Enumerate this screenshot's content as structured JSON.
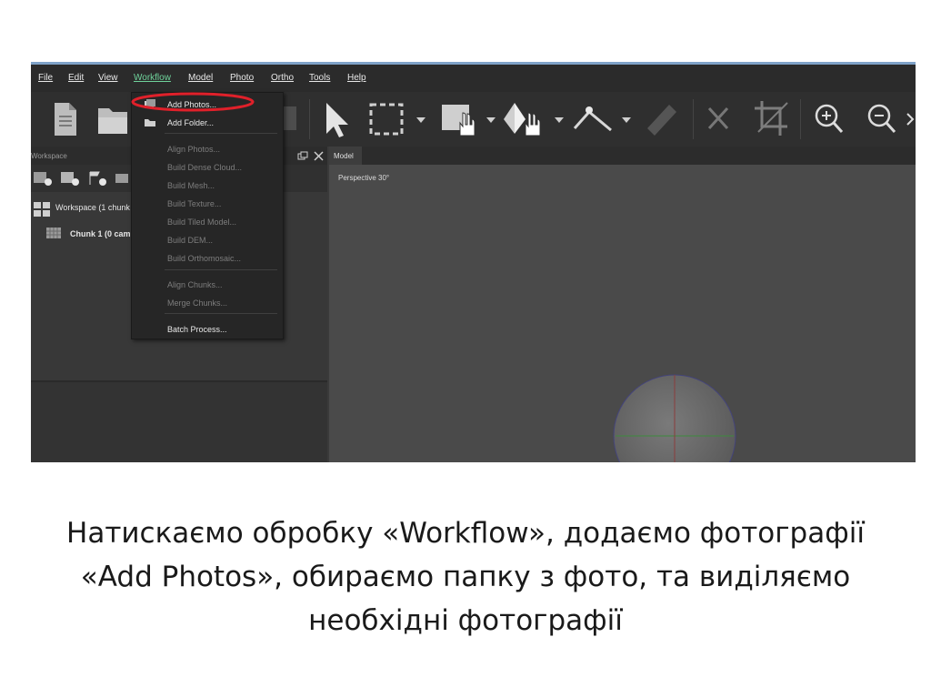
{
  "menubar": {
    "items": [
      "File",
      "Edit",
      "View",
      "Workflow",
      "Model",
      "Photo",
      "Ortho",
      "Tools",
      "Help"
    ],
    "active": "Workflow"
  },
  "workflow_menu": {
    "items": [
      {
        "label": "Add Photos...",
        "enabled": true,
        "highlighted": true
      },
      {
        "label": "Add Folder...",
        "enabled": true
      },
      {
        "label": "Align Photos...",
        "enabled": false
      },
      {
        "label": "Build Dense Cloud...",
        "enabled": false
      },
      {
        "label": "Build Mesh...",
        "enabled": false
      },
      {
        "label": "Build Texture...",
        "enabled": false
      },
      {
        "label": "Build Tiled Model...",
        "enabled": false
      },
      {
        "label": "Build DEM...",
        "enabled": false
      },
      {
        "label": "Build Orthomosaic...",
        "enabled": false
      },
      {
        "label": "Align Chunks...",
        "enabled": false
      },
      {
        "label": "Merge Chunks...",
        "enabled": false
      },
      {
        "label": "Batch Process...",
        "enabled": true
      }
    ],
    "annotation_color": "#e0202a"
  },
  "workspace": {
    "title": "Workspace",
    "root_label": "Workspace (1 chunk",
    "chunk_label": "Chunk 1 (0 cam"
  },
  "model_view": {
    "tab_label": "Model",
    "perspective_label": "Perspective 30°"
  },
  "toolbar": {
    "icons": [
      "new-document-icon",
      "open-folder-icon",
      "select-arrow-icon",
      "rectangle-selection-icon",
      "navigation-hand-icon",
      "move-object-icon",
      "ruler-line-icon",
      "measure-ruler-icon",
      "delete-icon",
      "crop-icon",
      "zoom-in-icon",
      "zoom-out-icon"
    ]
  },
  "caption": {
    "text": "Натискаємо обробку «Workflow», додаємо фотографії «Add Photos», обираємо папку з фото, та виділяємо необхідні фотографії"
  },
  "colors": {
    "accent": "#7fa2c8",
    "active_menu": "#6fd29b",
    "highlight_circle": "#e0202a"
  }
}
